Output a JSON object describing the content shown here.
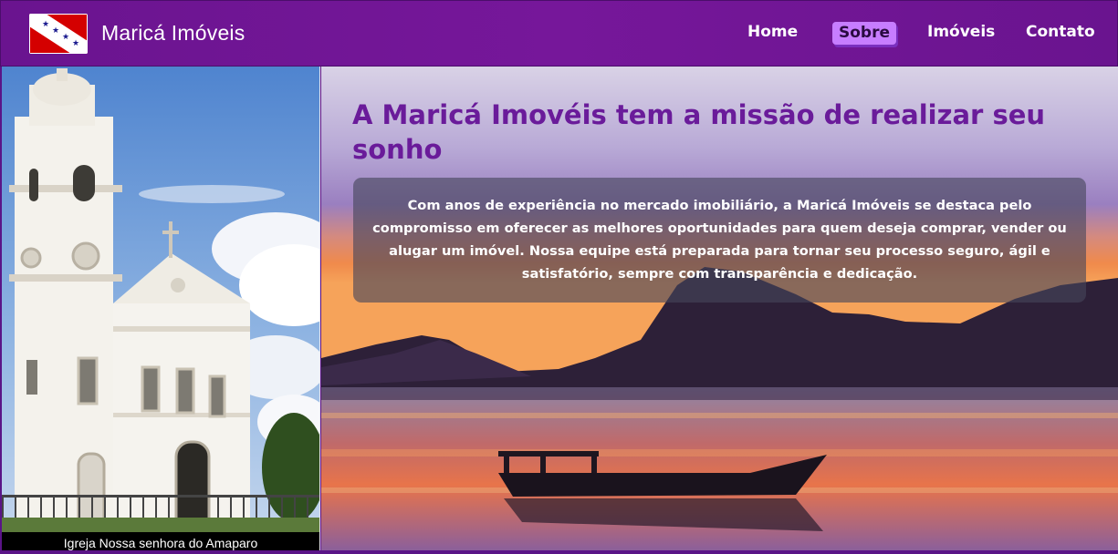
{
  "header": {
    "brand": "Maricá Imóveis",
    "logo": "marica-flag-logo",
    "nav": [
      {
        "label": "Home",
        "active": false
      },
      {
        "label": "Sobre",
        "active": true
      },
      {
        "label": "Imóveis",
        "active": false
      },
      {
        "label": "Contato",
        "active": false
      }
    ]
  },
  "photo": {
    "caption": "Igreja Nossa senhora do Amaparo",
    "subject": "church-photo"
  },
  "hero": {
    "title": "A Maricá Imovéis tem a missão de realizar seu sonho",
    "description": "Com anos de experiência no mercado imobiliário, a Maricá Imóveis se destaca pelo compromisso em oferecer as melhores oportunidades para quem deseja comprar, vender ou alugar um imóvel. Nossa equipe está preparada para tornar seu processo seguro, ágil e satisfatório, sempre com transparência e dedicação.",
    "background": "lagoon-sunset-photo"
  },
  "colors": {
    "nav_bg": "#6a148f",
    "active_tab": "#c77dff",
    "title": "#6a1b9a"
  }
}
